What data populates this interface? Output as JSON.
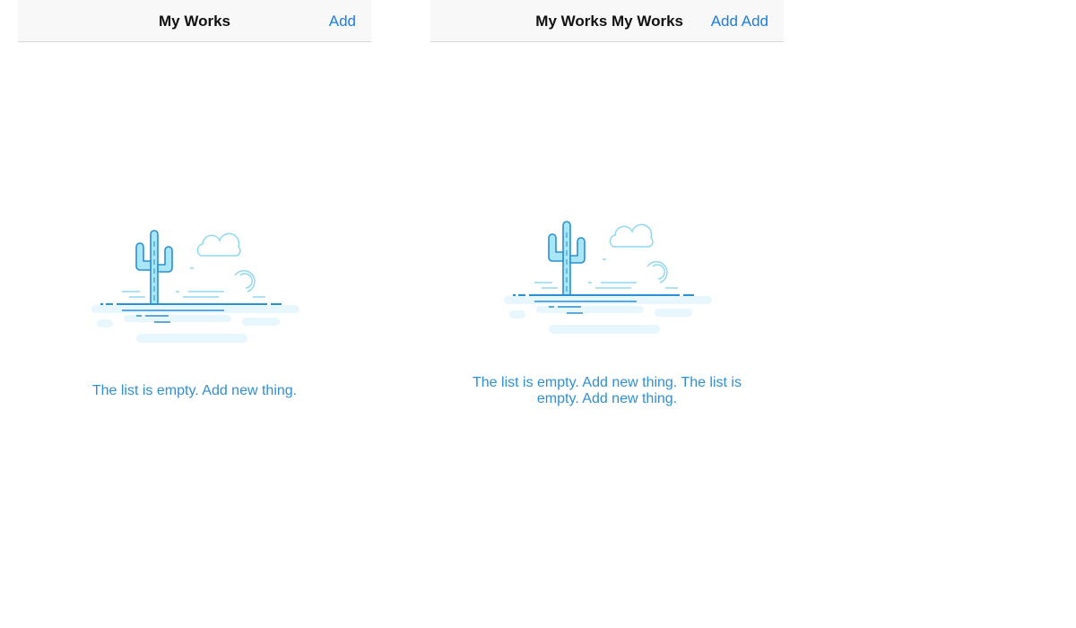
{
  "screens": [
    {
      "nav": {
        "title": "My Works",
        "action_label": "Add"
      },
      "empty_state": {
        "illustration": "cactus-desert-icon",
        "message": "The list is empty. Add new thing."
      }
    },
    {
      "nav": {
        "title": "My Works My Works",
        "action_label": "Add Add"
      },
      "empty_state": {
        "illustration": "cactus-desert-icon",
        "message": "The list is empty. Add new thing. The list is empty. Add new thing."
      }
    }
  ],
  "colors": {
    "accent": "#1a7fe0",
    "empty_text": "#2f8fd0",
    "navbar_bg": "#f8f8f8",
    "illustration_stroke": "#2a8fd3",
    "illustration_fill": "#a9e6f7",
    "illustration_pale": "#e8f7fd"
  }
}
